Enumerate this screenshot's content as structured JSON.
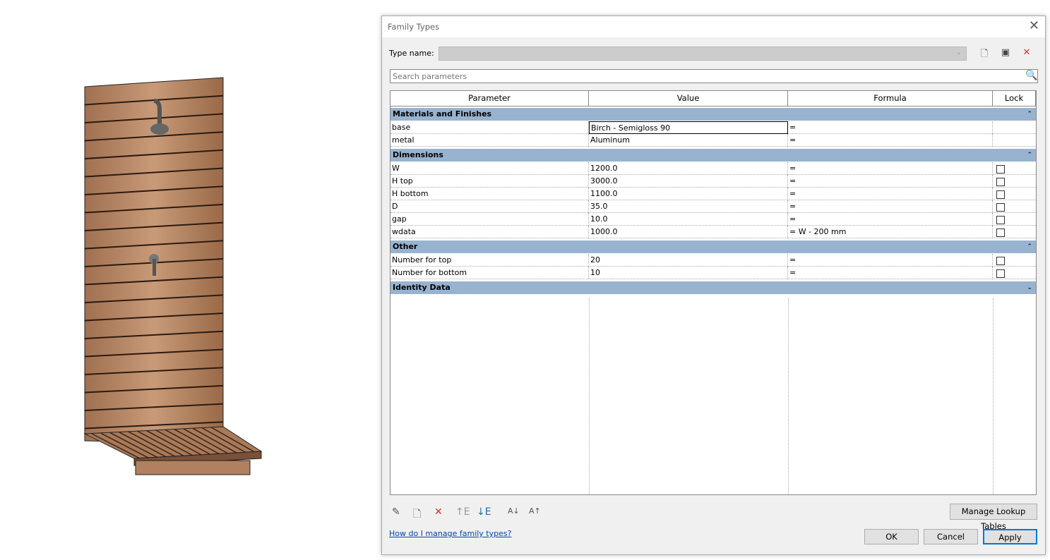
{
  "dialog": {
    "title": "Family Types",
    "type_name_label": "Type name:",
    "type_name_value": "",
    "search_placeholder": "Search parameters",
    "columns": [
      "Parameter",
      "Value",
      "Formula",
      "Lock"
    ],
    "groups": [
      {
        "name": "Materials and Finishes",
        "expanded": true,
        "rows": [
          {
            "parameter": "base",
            "value": "Birch - Semigloss 90",
            "formula": "=",
            "lock": null,
            "editing": true
          },
          {
            "parameter": "metal",
            "value": "Aluminum",
            "formula": "=",
            "lock": null
          }
        ]
      },
      {
        "name": "Dimensions",
        "expanded": true,
        "rows": [
          {
            "parameter": "W",
            "value": "1200.0",
            "formula": "=",
            "lock": false
          },
          {
            "parameter": "H top",
            "value": "3000.0",
            "formula": "=",
            "lock": false
          },
          {
            "parameter": "H bottom",
            "value": "1100.0",
            "formula": "=",
            "lock": false
          },
          {
            "parameter": "D",
            "value": "35.0",
            "formula": "=",
            "lock": false
          },
          {
            "parameter": "gap",
            "value": "10.0",
            "formula": "=",
            "lock": false
          },
          {
            "parameter": "wdata",
            "value": "1000.0",
            "formula": "= W - 200 mm",
            "lock": false
          }
        ]
      },
      {
        "name": "Other",
        "expanded": true,
        "rows": [
          {
            "parameter": "Number for top",
            "value": "20",
            "formula": "=",
            "lock": false
          },
          {
            "parameter": "Number for bottom",
            "value": "10",
            "formula": "=",
            "lock": false
          }
        ]
      },
      {
        "name": "Identity Data",
        "expanded": false,
        "rows": []
      }
    ],
    "manage_lookup_label": "Manage Lookup Tables",
    "help_link": "How do I manage family types?",
    "ok_label": "OK",
    "cancel_label": "Cancel",
    "apply_label": "Apply"
  }
}
